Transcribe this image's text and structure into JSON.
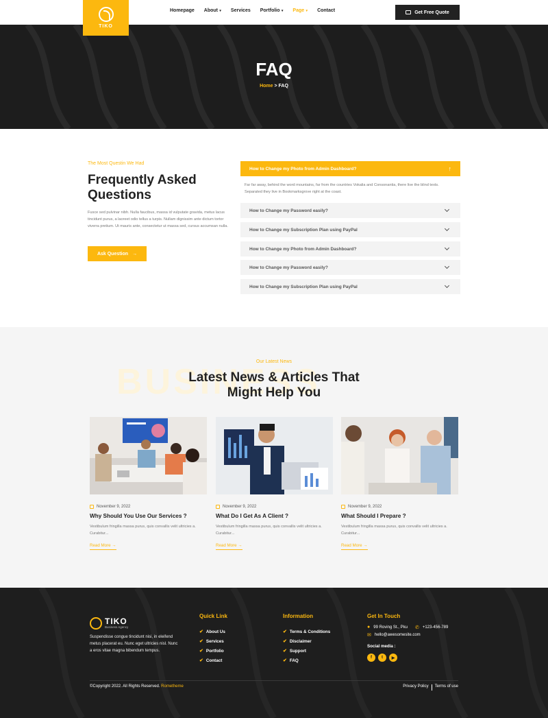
{
  "header": {
    "logo_text": "TIKO",
    "nav": [
      {
        "label": "Homepage",
        "caret": false,
        "active": false
      },
      {
        "label": "About",
        "caret": true,
        "active": false
      },
      {
        "label": "Services",
        "caret": false,
        "active": false
      },
      {
        "label": "Portfolio",
        "caret": true,
        "active": false
      },
      {
        "label": "Page",
        "caret": true,
        "active": true
      },
      {
        "label": "Contact",
        "caret": false,
        "active": false
      }
    ],
    "quote_button": "Get Free Quote"
  },
  "hero": {
    "title": "FAQ",
    "breadcrumb_home": "Home",
    "breadcrumb_sep": " > ",
    "breadcrumb_current": "FAQ"
  },
  "faq": {
    "subtitle": "The Most Questin We Had",
    "title": "Frequently Asked Questions",
    "description": "Fusce sed pulvinar nibh. Nulla faucibus, massa id vulputate gravida, metus lacus tincidunt purus, a laoreet odio tellus a turpis. Nullam dignissim ante dictum tortor viverra pretium. Ut mauris ante, consectetur ut massa sed, cursus accumsan nulla.",
    "ask_button": "Ask Question",
    "open_item": {
      "question": "How to Change my Photo from Admin Dashboard?",
      "answer": "Far far away, behind the word mountains, far from the countries Vokalia and Consonantia, there live the blind texts. Separated they live in Bookmarksgrove right at the coast."
    },
    "items": [
      "How to Change my Password easily?",
      "How to Change my Subscription Plan using PayPal",
      "How to Change my Photo from Admin Dashboard?",
      "How to Change my Password easily?",
      "How to Change my Subscription Plan using PayPal"
    ]
  },
  "news": {
    "subtitle": "Our Latest News",
    "background_word": "BUSINESS",
    "title_line1": "Latest News & Articles That",
    "title_line2": "Might Help You",
    "cards": [
      {
        "date": "November 9, 2022",
        "title": "Why Should You Use Our Services ?",
        "text": "Vestibulum fringilla massa purus, quis convallis velit ultricies a. Curabitur...",
        "link": "Read More"
      },
      {
        "date": "November 9, 2022",
        "title": "What Do I Get As A Client ?",
        "text": "Vestibulum fringilla massa purus, quis convallis velit ultricies a. Curabitur...",
        "link": "Read More"
      },
      {
        "date": "November 9, 2022",
        "title": "What Should I Prepare ?",
        "text": "Vestibulum fringilla massa purus, quis convallis velit ultricies a. Curabitur...",
        "link": "Read More"
      }
    ]
  },
  "footer": {
    "logo_name": "TIKO",
    "logo_tag": "Business Agency",
    "about": "Suspendisse congue tincidunt nisi, in eleifend metus placerat eu. Nunc eget ultricies nisl. Nunc a eros vitae magna bibendum tempus.",
    "quick_link_title": "Quick Link",
    "quick_links": [
      "About Us",
      "Services",
      "Portfolio",
      "Contact"
    ],
    "info_title": "Information",
    "info_links": [
      "Terms & Conditions",
      "Disclaimer",
      "Support",
      "FAQ"
    ],
    "contact_title": "Get In Touch",
    "address": "99 Roving St., Pku",
    "phone": "+123-456-789",
    "email": "hello@awesomesite.com",
    "social_label": "Social media :",
    "copyright": "©Copyright 2022. All Rights Reserved.",
    "brand": "Rometheme",
    "privacy": "Privacy Policy",
    "terms": "Terms of use"
  },
  "colors": {
    "accent": "#fcb80f",
    "dark": "#1e1e1e"
  }
}
